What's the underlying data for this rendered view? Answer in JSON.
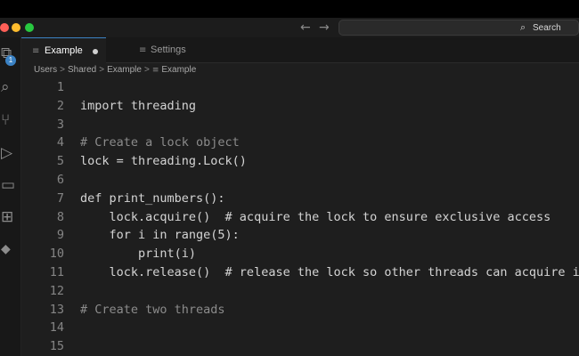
{
  "window": {
    "nav_back": "←",
    "nav_forward": "→",
    "search_label": "Search"
  },
  "activity_bar": {
    "items": [
      {
        "name": "explorer-icon",
        "glyph": "⧉",
        "badge": "1"
      },
      {
        "name": "search-icon",
        "glyph": "⌕"
      },
      {
        "name": "source-control-icon",
        "glyph": "⑂"
      },
      {
        "name": "run-debug-icon",
        "glyph": "▷"
      },
      {
        "name": "remote-explorer-icon",
        "glyph": "▭"
      },
      {
        "name": "extensions-icon",
        "glyph": "⊞"
      },
      {
        "name": "docker-icon",
        "glyph": "🐳"
      }
    ]
  },
  "tabs": [
    {
      "label": "Example",
      "active": true,
      "modified": true,
      "icon": "≡"
    },
    {
      "label": "Settings",
      "active": false,
      "modified": false,
      "icon": "≡"
    }
  ],
  "breadcrumb": [
    "Users",
    "Shared",
    "Example",
    "Example"
  ],
  "editor": {
    "lines": [
      {
        "n": "1",
        "text": ""
      },
      {
        "n": "2",
        "text": "import threading"
      },
      {
        "n": "3",
        "text": ""
      },
      {
        "n": "4",
        "text": "# Create a lock object",
        "comment": true
      },
      {
        "n": "5",
        "text": "lock = threading.Lock()"
      },
      {
        "n": "6",
        "text": ""
      },
      {
        "n": "7",
        "text": "def print_numbers():"
      },
      {
        "n": "8",
        "text": "    lock.acquire()  # acquire the lock to ensure exclusive access"
      },
      {
        "n": "9",
        "text": "    for i in range(5):"
      },
      {
        "n": "10",
        "text": "        print(i)"
      },
      {
        "n": "11",
        "text": "    lock.release()  # release the lock so other threads can acquire it"
      },
      {
        "n": "12",
        "text": ""
      },
      {
        "n": "13",
        "text": "# Create two threads",
        "comment": true
      },
      {
        "n": "14",
        "text": ""
      },
      {
        "n": "15",
        "text": ""
      }
    ]
  }
}
